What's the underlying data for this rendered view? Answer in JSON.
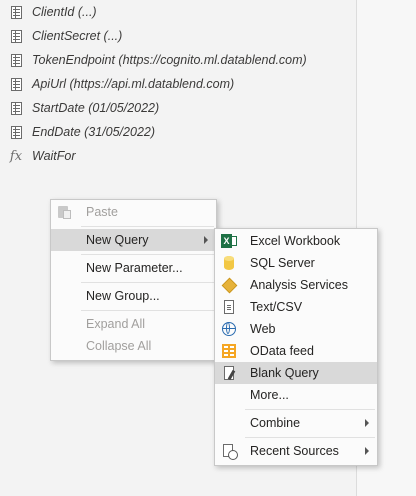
{
  "queries": [
    {
      "icon": "parameter-icon",
      "label": "ClientId (...)"
    },
    {
      "icon": "parameter-icon",
      "label": "ClientSecret (...)"
    },
    {
      "icon": "parameter-icon",
      "label": "TokenEndpoint (https://cognito.ml.datablend.com)"
    },
    {
      "icon": "parameter-icon",
      "label": "ApiUrl (https://api.ml.datablend.com)"
    },
    {
      "icon": "parameter-icon",
      "label": "StartDate (01/05/2022)"
    },
    {
      "icon": "parameter-icon",
      "label": "EndDate (31/05/2022)"
    },
    {
      "icon": "fx-icon",
      "label": "WaitFor"
    }
  ],
  "context_menu": {
    "paste": "Paste",
    "new_query": "New Query",
    "new_parameter": "New Parameter...",
    "new_group": "New Group...",
    "expand_all": "Expand All",
    "collapse_all": "Collapse All"
  },
  "submenu": {
    "excel_workbook": "Excel Workbook",
    "sql_server": "SQL Server",
    "analysis_services": "Analysis Services",
    "text_csv": "Text/CSV",
    "web": "Web",
    "odata_feed": "OData feed",
    "blank_query": "Blank Query",
    "more": "More...",
    "combine": "Combine",
    "recent_sources": "Recent Sources"
  },
  "icons": {
    "fx": "fx",
    "excel": "X"
  },
  "colors": {
    "highlight": "#d9d9d9",
    "excel_green": "#1e7145",
    "odata_orange": "#f5a623"
  }
}
